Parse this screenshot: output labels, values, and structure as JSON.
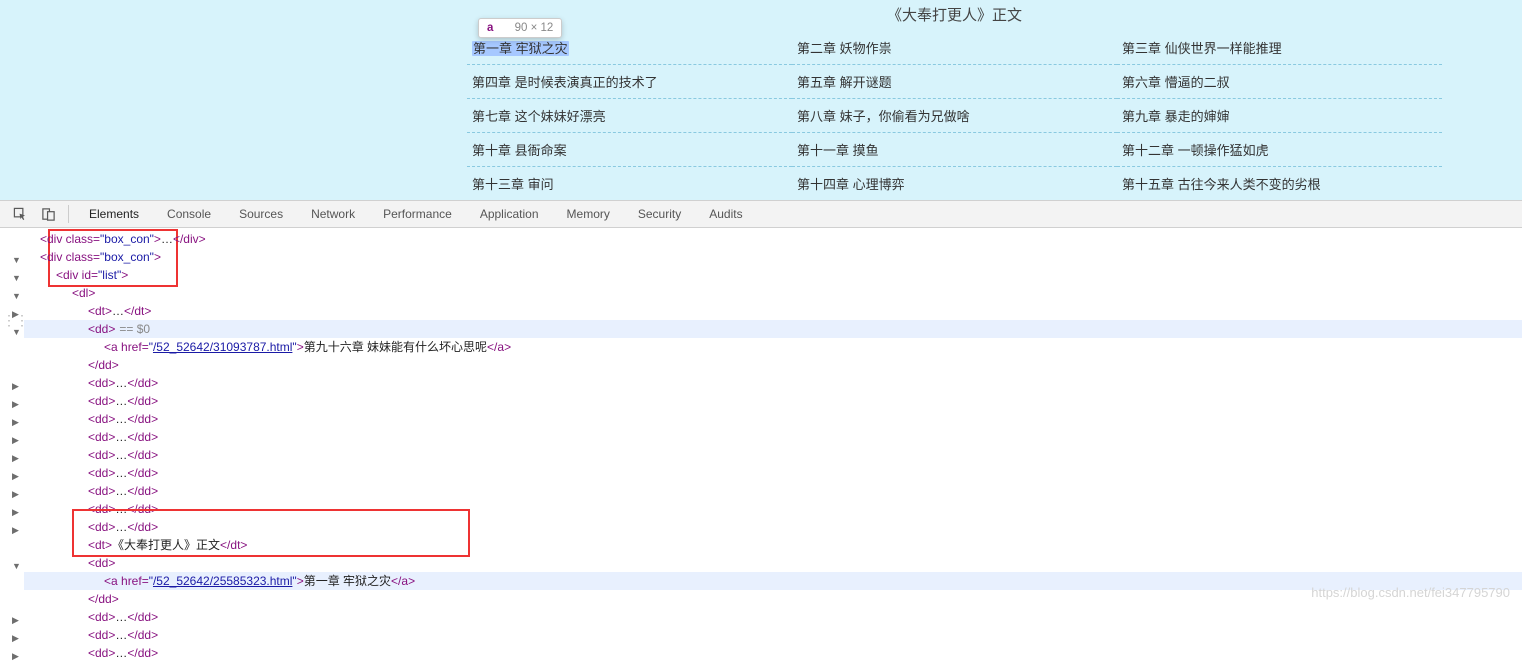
{
  "page": {
    "section_title": "《大奉打更人》正文",
    "chapters": [
      [
        "第一章 牢狱之灾",
        "第二章 妖物作祟",
        "第三章 仙侠世界一样能推理"
      ],
      [
        "第四章 是时候表演真正的技术了",
        "第五章 解开谜题",
        "第六章 懵逼的二叔"
      ],
      [
        "第七章 这个妹妹好漂亮",
        "第八章 妹子，你偷看为兄做啥",
        "第九章 暴走的婶婶"
      ],
      [
        "第十章 县衙命案",
        "第十一章 摸鱼",
        "第十二章 一顿操作猛如虎"
      ],
      [
        "第十三章 审问",
        "第十四章 心理博弈",
        "第十五章 古往今来人类不变的劣根"
      ]
    ]
  },
  "tooltip": {
    "tag": "a",
    "dims": "90 × 12"
  },
  "devtools": {
    "tabs": [
      "Elements",
      "Console",
      "Sources",
      "Network",
      "Performance",
      "Application",
      "Memory",
      "Security",
      "Audits"
    ]
  },
  "dom": {
    "partial_top": "<div class=\"box_con\">…</div>",
    "box_con": "box_con",
    "list_id": "list",
    "dd_text": "第九十六章 妹妹能有什么坏心思呢",
    "dd_href": "/52_52642/31093787.html",
    "dt_text": "《大奉打更人》正文",
    "dd2_text": "第一章 牢狱之灾",
    "dd2_href": "/52_52642/25585323.html",
    "eq0": "== $0"
  },
  "watermark": "https://blog.csdn.net/fei347795790"
}
